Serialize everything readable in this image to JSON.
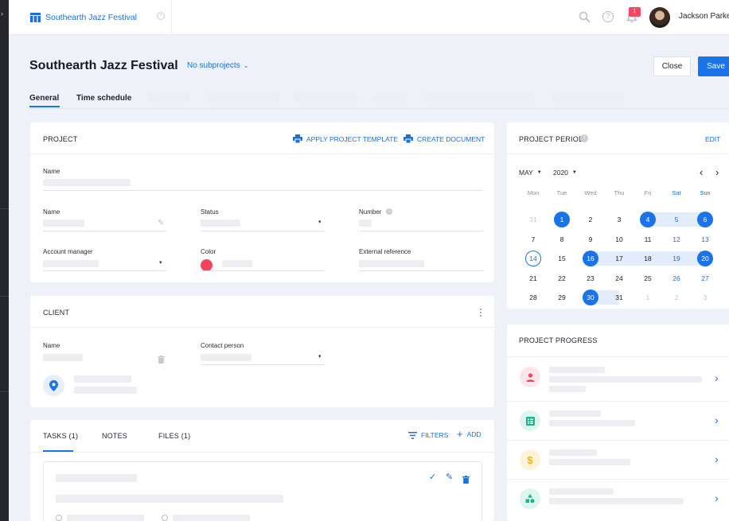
{
  "app": {
    "title": "Southearth Jazz Festival"
  },
  "user": {
    "name": "Jackson Parke",
    "notif_count": "1"
  },
  "page": {
    "title": "Southearth Jazz Festival",
    "subprojects": "No subprojects",
    "close_label": "Close",
    "save_label": "Save"
  },
  "tabs": [
    {
      "label": "General"
    },
    {
      "label": "Time schedule"
    }
  ],
  "project": {
    "title": "PROJECT",
    "apply_template": "APPLY PROJECT TEMPLATE",
    "create_document": "CREATE DOCUMENT",
    "name_label": "Name",
    "name2_label": "Name",
    "status_label": "Status",
    "number_label": "Number",
    "account_manager_label": "Account manager",
    "color_label": "Color",
    "external_ref_label": "External reference",
    "color_value": "#f0455a"
  },
  "client": {
    "title": "CLIENT",
    "name_label": "Name",
    "contact_label": "Contact person"
  },
  "tasks": {
    "tab_tasks": "TASKS (1)",
    "tab_notes": "NOTES",
    "tab_files": "FILES (1)",
    "filters": "FILTERS",
    "add": "ADD"
  },
  "period": {
    "title": "PROJECT PERIOD",
    "edit": "EDIT",
    "month": "MAY",
    "year": "2020",
    "weekdays": [
      "Mon",
      "Tue",
      "Wed",
      "Thu",
      "Fri",
      "Sat",
      "Sun"
    ],
    "weeks": [
      [
        "31",
        "1",
        "2",
        "3",
        "4",
        "5",
        "6"
      ],
      [
        "7",
        "8",
        "9",
        "10",
        "11",
        "12",
        "13"
      ],
      [
        "14",
        "15",
        "16",
        "17",
        "18",
        "19",
        "20"
      ],
      [
        "21",
        "22",
        "23",
        "24",
        "25",
        "26",
        "27"
      ],
      [
        "28",
        "29",
        "30",
        "31",
        "1",
        "2",
        "3"
      ]
    ]
  },
  "progress": {
    "title": "PROJECT PROGRESS"
  },
  "colors": {
    "accent": "#1a73e8",
    "page_bg": "#eef1f8"
  }
}
